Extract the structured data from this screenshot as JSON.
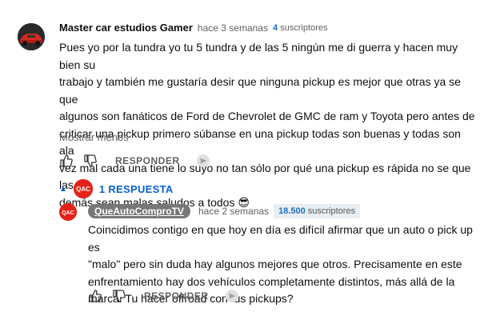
{
  "comment": {
    "author": "Master car estudios Gamer",
    "time": "hace 3 semanas",
    "subs_count": "4",
    "subs_label": "suscriptores",
    "text_lines": [
      "Pues yo por la tundra yo tu 5 tundra y de las 5 ningún me di guerra y hacen muy bien su",
      "trabajo y también me gustaría desir que ninguna pickup es mejor que otras ya se que",
      "algunos son fanáticos de Ford de Chevrolet de GMC de ram y Toyota pero antes de",
      "criticar una pickup primero súbanse en una pickup todas son buenas y todas son ala",
      "vez mal cada una tiene lo suyo no tan sólo por qué una pickup es rápida no se que las",
      "demás sean malas saludos a todos 😎"
    ],
    "show_less": "Mostrar menos",
    "reply_label": "RESPONDER"
  },
  "replies_toggle": {
    "label": "1 RESPUESTA"
  },
  "reply": {
    "author": "QueAutoComproTV",
    "time": "hace 2 semanas",
    "subs_count": "18.500",
    "subs_label": "suscriptores",
    "text_lines": [
      "Coincidimos contigo en que hoy en día es difícil afirmar que un auto o pick up es",
      "\"malo\" pero sin duda hay algunos mejores que otros. Precisamente en este",
      "enfrentamiento hay dos vehículos completamente distintos, más allá de la",
      "marca. Tu hacer offroad con tus pickups?"
    ],
    "reply_label": "RESPONDER"
  },
  "colors": {
    "link_blue": "#065fd4",
    "channel_red": "#e62117",
    "chip_gray": "#777777"
  }
}
